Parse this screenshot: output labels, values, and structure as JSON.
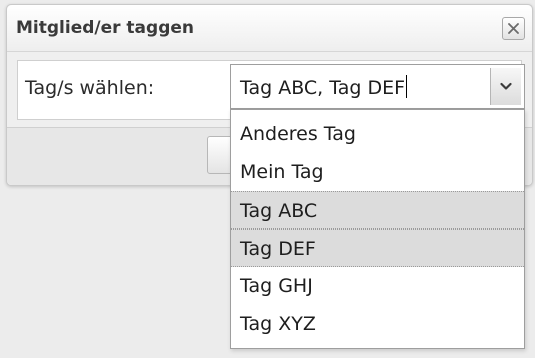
{
  "dialog": {
    "title": "Mitglied/er taggen",
    "close_icon": "close-icon"
  },
  "form": {
    "tag_label": "Tag/s wählen:",
    "select_value": "Tag ABC, Tag DEF",
    "dropdown_arrow_icon": "chevron-down-icon"
  },
  "dropdown": {
    "options": [
      {
        "label": "Anderes Tag",
        "selected": false
      },
      {
        "label": "Mein Tag",
        "selected": false
      },
      {
        "label": "Tag ABC",
        "selected": true
      },
      {
        "label": "Tag DEF",
        "selected": true
      },
      {
        "label": "Tag GHJ",
        "selected": false
      },
      {
        "label": "Tag XYZ",
        "selected": false
      }
    ]
  }
}
